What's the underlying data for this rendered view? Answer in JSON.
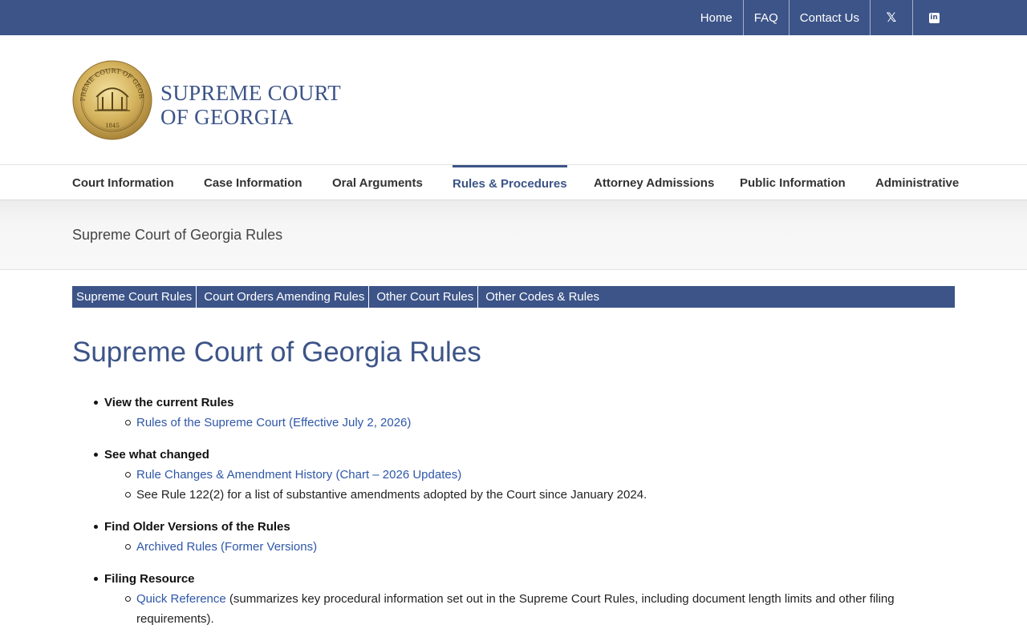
{
  "topnav": {
    "links": [
      "Home",
      "FAQ",
      "Contact Us"
    ],
    "x_icon_glyph": "𝕏",
    "linkedin_glyph": "in"
  },
  "brand": {
    "line1": "SUPREME COURT",
    "line2": "OF GEORGIA",
    "seal_text": "SUPREME COURT OF GEORGIA",
    "seal_year": "1845"
  },
  "mainnav": {
    "items": [
      "Court Information",
      "Case Information",
      "Oral Arguments",
      "Rules & Procedures",
      "Attorney Admissions",
      "Public Information",
      "Administrative"
    ],
    "active": "Rules & Procedures"
  },
  "page_title": "Supreme Court of Georgia Rules",
  "subtabs": [
    "Supreme Court Rules",
    "Court Orders Amending Rules",
    "Other Court Rules",
    "Other Codes & Rules"
  ],
  "heading": "Supreme Court of Georgia Rules",
  "sections": [
    {
      "title": "View the current Rules",
      "items": [
        {
          "link": "Rules of the Supreme Court (Effective July 2, 2026)",
          "text": ""
        }
      ]
    },
    {
      "title": "See what changed",
      "items": [
        {
          "link": "Rule Changes & Amendment History (Chart – 2026 Updates)",
          "text": ""
        },
        {
          "link": "",
          "text": "See Rule 122(2) for a list of substantive amendments adopted by the Court since January 2024."
        }
      ]
    },
    {
      "title": "Find Older Versions of the Rules",
      "items": [
        {
          "link": "Archived Rules (Former Versions)",
          "text": ""
        }
      ]
    },
    {
      "title": "Filing Resource",
      "items": [
        {
          "link": "Quick Reference",
          "text": " (summarizes key procedural information set out in the Supreme Court Rules, including document length limits and other filing requirements)."
        }
      ]
    }
  ],
  "colors": {
    "brand_blue": "#3c5488",
    "link_blue": "#2e57a8",
    "seal_gold": "#c9a646"
  }
}
